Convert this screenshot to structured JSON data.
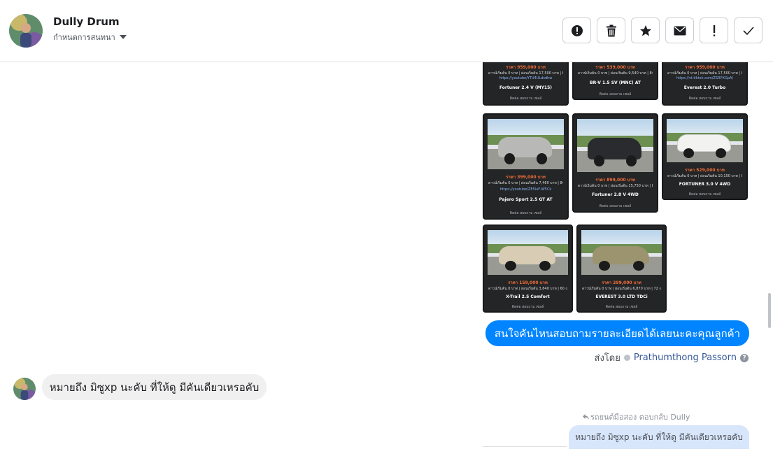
{
  "header": {
    "name": "Dully Drum",
    "subtitle": "กำหนดการสนทนา"
  },
  "toolbar": {
    "buttons": [
      {
        "icon": "alert-circle-icon"
      },
      {
        "icon": "trash-icon"
      },
      {
        "icon": "star-icon"
      },
      {
        "icon": "envelope-icon"
      },
      {
        "icon": "exclamation-icon"
      },
      {
        "icon": "checkmark-icon"
      }
    ]
  },
  "listings": [
    {
      "price": "ราคา 959,000 บาท",
      "detail": "ดาวน์เริ่มต้น 0 บาท | ผ่อนเริ่มต้น 17,500 บาท | 84 งวด",
      "extra": "https://youtube/YTU4ULdsdhw",
      "model": "Fortuner 2.4 V (MY15)",
      "footer": "ติดต่อ สอบถาม เซลล์"
    },
    {
      "price": "ราคา 539,000 บาท",
      "detail": "ดาวน์เริ่มต้น 0 บาท | ผ่อนเริ่มต้น 9,540 บาท | 84 งวด",
      "extra": "",
      "model": "BR-V 1.5 SV (MNC) AT",
      "footer": "ติดต่อ สอบถาม เซลล์"
    },
    {
      "price": "ราคา 959,000 บาท",
      "detail": "ดาวน์เริ่มต้น 0 บาท | ผ่อนเริ่มต้น 17,500 บาท | 84 งวด",
      "extra": "https://vt.tiktok.com/ZSRPXGpA/",
      "model": "Everest 2.0 Turbo",
      "footer": "ติดต่อ สอบถาม เซลล์"
    },
    {
      "price": "ราคา 399,000 บาท",
      "detail": "ดาวน์เริ่มต้น 0 บาท | ผ่อนเริ่มต้น 7,460 บาท | 84 งวด",
      "extra": "https://youtube/ZE5luF-W5Ck",
      "model": "Pajero Sport 2.5 GT AT",
      "footer": "ติดต่อ สอบถาม เซลล์"
    },
    {
      "price": "ราคา 899,000 บาท",
      "detail": "ดาวน์เริ่มต้น 0 บาท | ผ่อนเริ่มต้น 15,750 บาท | 84 งวด",
      "extra": "",
      "model": "Fortuner 2.8 V 4WD",
      "footer": "ติดต่อ สอบถาม เซลล์"
    },
    {
      "price": "ราคา 529,000 บาท",
      "detail": "ดาวน์เริ่มต้น 0 บาท | ผ่อนเริ่มต้น 10,150 บาท | 84 งวด",
      "extra": "",
      "model": "FORTUNER 3.0 V 4WD",
      "footer": "ติดต่อ สอบถาม เซลล์"
    },
    {
      "price": "ราคา 159,000 บาท",
      "detail": "ดาวน์เริ่มต้น 0 บาท | ผ่อนเริ่มต้น 3,840 บาท | 60 งวด",
      "extra": "",
      "model": "X-Trail 2.5 Comfort",
      "footer": "ติดต่อ สอบถาม เซลล์"
    },
    {
      "price": "ราคา 299,000 บาท",
      "detail": "ดาวน์เริ่มต้น 0 บาท | ผ่อนเริ่มต้น 6,870 บาท | 72 งวด",
      "extra": "",
      "model": "EVEREST 3.0 LTD TDCi",
      "footer": "ติดต่อ สอบถาม เซลล์"
    }
  ],
  "messages": {
    "outgoing": "สนใจคันไหนสอบถามรายละเอียดได้เลยนะคะคุณลูกค้า",
    "sent_by_prefix": "ส่งโดย",
    "sent_by_name": "Prathumthong Passorn",
    "incoming": "หมายถึง มิซูxp นะคับ ที่ให้ดู มีคันเดียวเหรอคับ",
    "reply_label": "รถยนต์มือสอง ตอบกลับ Dully",
    "reply_quote": "หมายถึง มิซูxp นะคับ ที่ให้ดู มีคันเดียวเหรอคับ"
  },
  "colors": {
    "accent": "#0084ff",
    "incoming_bubble": "#f1f0f0",
    "reply_bubble": "#d8e6fb",
    "card_bg": "#242526",
    "price": "#f26e3a",
    "sender_link": "#385898"
  }
}
